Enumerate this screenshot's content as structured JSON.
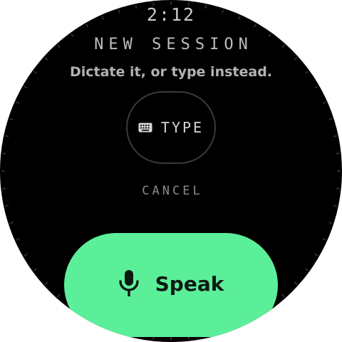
{
  "status": {
    "time": "2:12"
  },
  "header": {
    "title": "NEW SESSION",
    "subtitle": "Dictate it, or type instead."
  },
  "actions": {
    "type_label": "TYPE",
    "type_icon": "keyboard-icon",
    "cancel_label": "CANCEL",
    "speak_label": "Speak",
    "speak_icon": "microphone-icon"
  },
  "colors": {
    "background": "#000000",
    "accent": "#5cef9a",
    "text_primary": "#d6d6d6",
    "text_muted": "#8a8a8a"
  }
}
